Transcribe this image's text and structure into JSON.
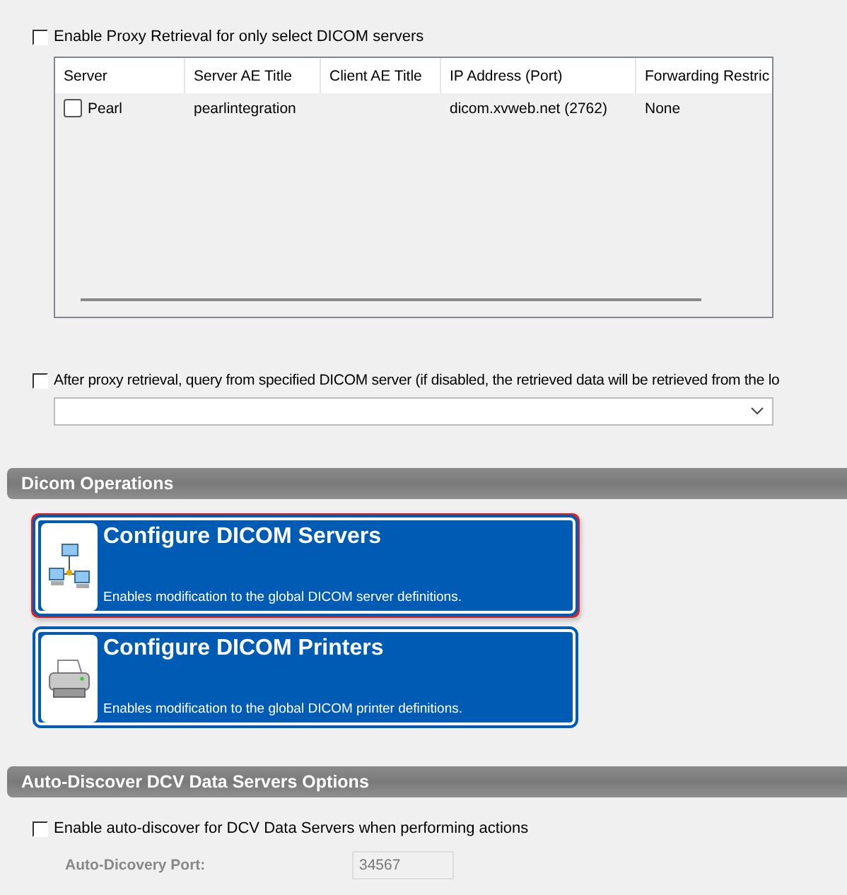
{
  "proxy_select": {
    "label": "Enable Proxy Retrieval for only select DICOM servers",
    "checked": false
  },
  "servers_table": {
    "columns": [
      "Server",
      "Server AE Title",
      "Client AE Title",
      "IP Address (Port)",
      "Forwarding Restric"
    ],
    "rows": [
      {
        "checked": false,
        "cells": [
          "Pearl",
          "pearlintegration",
          "",
          "dicom.xvweb.net (2762)",
          "None"
        ]
      }
    ]
  },
  "proxy_query": {
    "label": "After proxy retrieval, query from specified DICOM server (if disabled, the retrieved data will be retrieved from the lo",
    "checked": false
  },
  "sections": [
    {
      "title": "Dicom Operations",
      "cards": [
        {
          "kind": "network",
          "title": "Configure DICOM Servers",
          "description": "Enables modification to the global DICOM server definitions.",
          "selected": true
        },
        {
          "kind": "printer",
          "title": "Configure DICOM Printers",
          "description": "Enables modification to the global DICOM printer definitions.",
          "selected": false
        }
      ]
    },
    {
      "title": "Auto-Discover DCV Data Servers Options",
      "options": [
        {
          "label": "Enable auto-discover for DCV Data Servers when performing actions",
          "checked": false
        }
      ],
      "port": {
        "label": "Auto-Dicovery Port:",
        "value": "34567",
        "disabled": true
      }
    }
  ]
}
